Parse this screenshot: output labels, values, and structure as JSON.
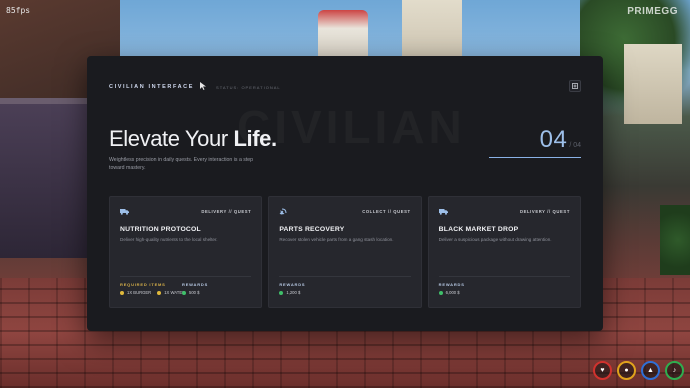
{
  "overlay": {
    "fps": "85fps",
    "watermark": "PRIMEGG"
  },
  "header": {
    "brand": "CIVILIAN INTERFACE",
    "status": "STATUS: OPERATIONAL",
    "cursor_icon": "cursor-arrow-icon",
    "expand_icon": "expand-icon"
  },
  "hero": {
    "ghost_text": "CIVILIAN",
    "title_light": "Elevate Your ",
    "title_bold": "Life.",
    "subtitle": "Weightless precision in daily quests. Every interaction is a step toward mastery.",
    "counter_current": "04",
    "counter_total": "/ 04"
  },
  "cards": [
    {
      "icon": "truck-icon",
      "tag": "DELIVERY // QUEST",
      "title": "NUTRITION PROTOCOL",
      "description": "Deliver high-quality nutrients to the local shelter.",
      "required_label": "REQUIRED ITEMS",
      "required_items": [
        {
          "text": "1X BURGER",
          "color": "#e0b93c"
        },
        {
          "text": "1X WATER",
          "color": "#e0b93c"
        }
      ],
      "rewards_label": "REWARDS",
      "reward": "500 $"
    },
    {
      "icon": "satellite-icon",
      "tag": "COLLECT // QUEST",
      "title": "PARTS RECOVERY",
      "description": "Recover stolen vehicle parts from a gang stash location.",
      "rewards_label": "REWARDS",
      "reward": "1,200 $"
    },
    {
      "icon": "truck-icon",
      "tag": "DELIVERY // QUEST",
      "title": "BLACK MARKET DROP",
      "description": "Deliver a suspicious package without drawing attention.",
      "rewards_label": "REWARDS",
      "reward": "6,000 $"
    }
  ],
  "colors": {
    "accent": "#8ab2e6",
    "gold": "#d9b24a",
    "reward_dot": "#3fbf6a",
    "panel_bg": "#1a1b1f"
  },
  "hud": [
    {
      "name": "health-ring-icon",
      "color": "#d0322e",
      "glyph": "♥"
    },
    {
      "name": "hunger-ring-icon",
      "color": "#e0a21c",
      "glyph": "●"
    },
    {
      "name": "thirst-ring-icon",
      "color": "#2f6fd6",
      "glyph": "▲"
    },
    {
      "name": "voice-ring-icon",
      "color": "#2fae4f",
      "glyph": "♪"
    }
  ]
}
